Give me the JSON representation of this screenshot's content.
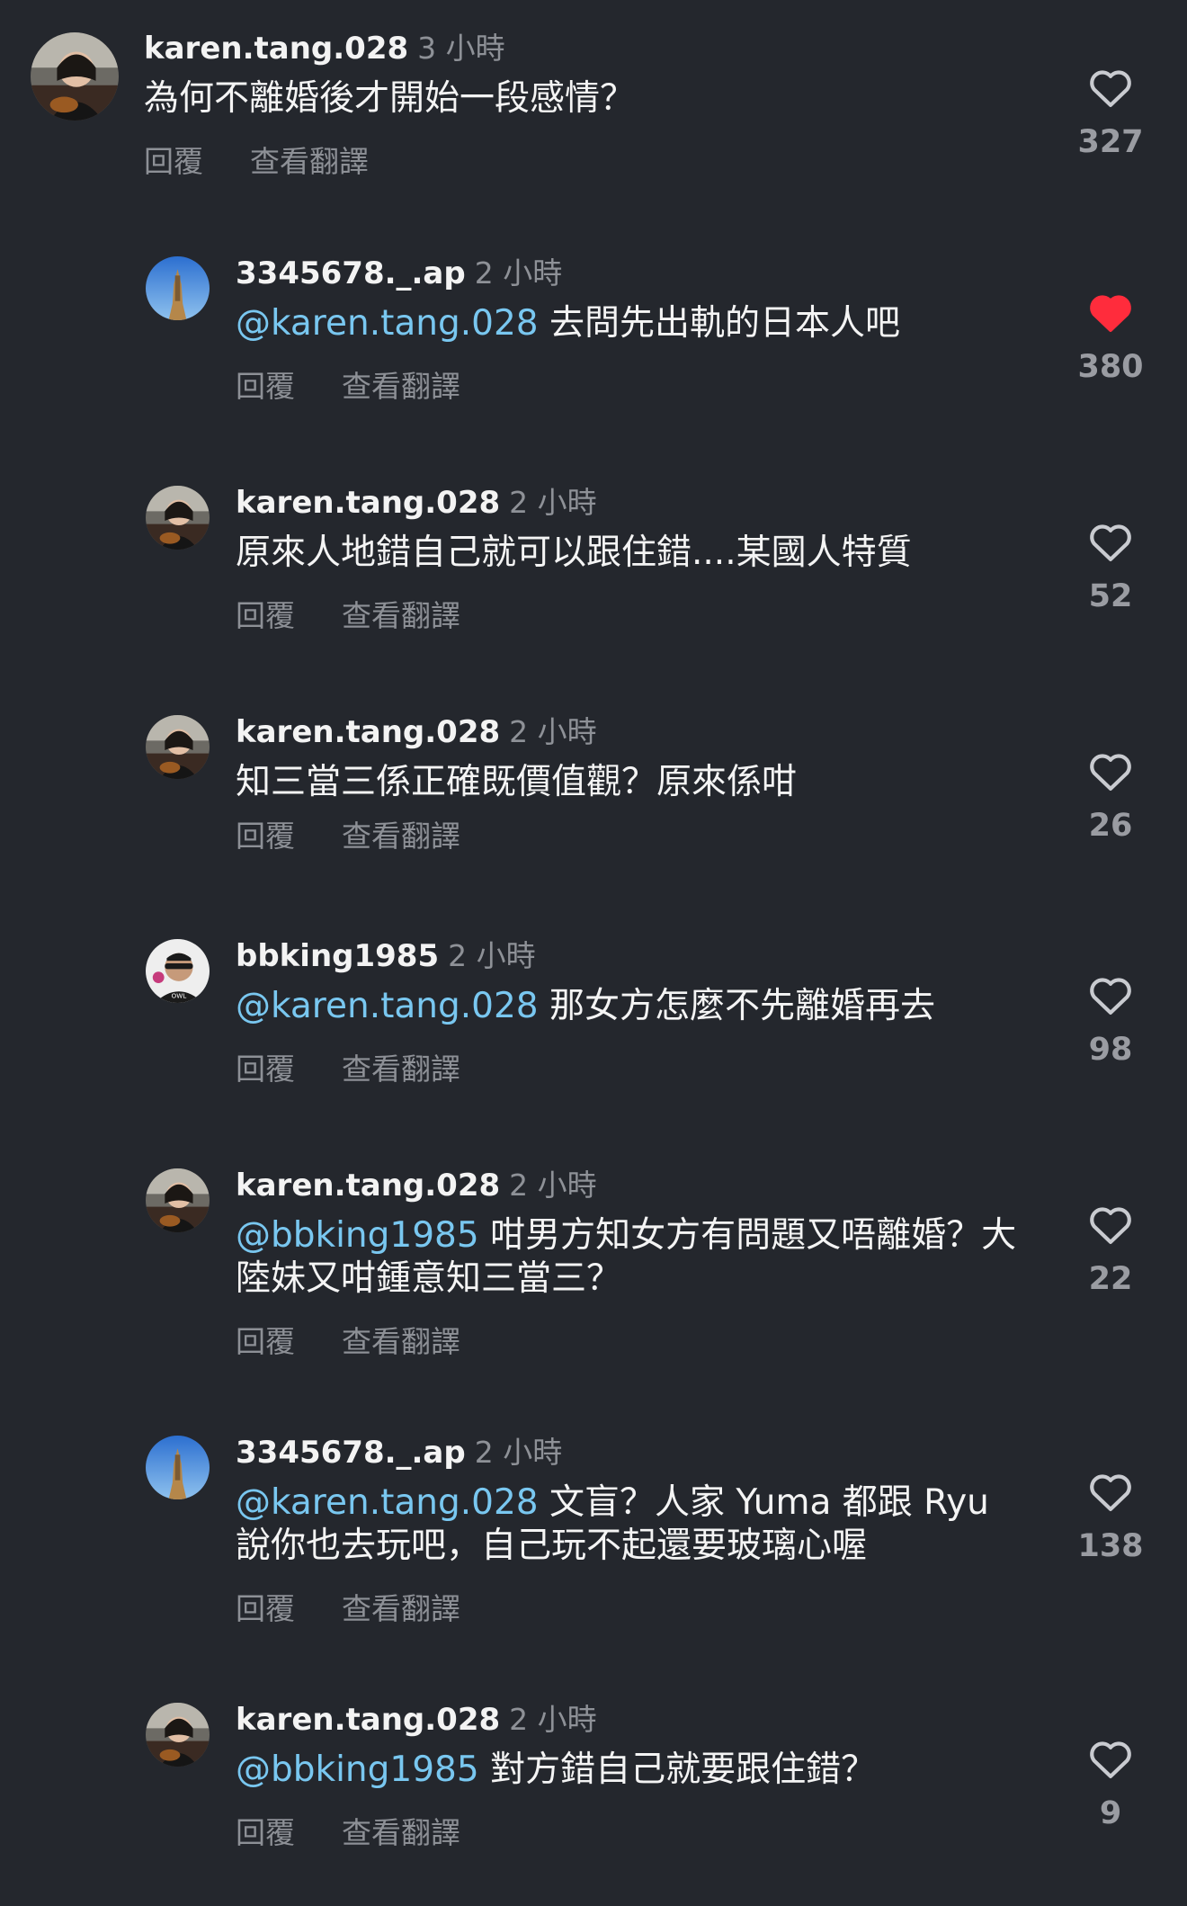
{
  "colors": {
    "background": "#24272d",
    "mention": "#79c7f0",
    "liked": "#ff2c3c",
    "muted": "#8d9096"
  },
  "actions": {
    "reply": "回覆",
    "translate": "查看翻譯"
  },
  "comments": [
    {
      "username": "karen.tang.028",
      "time": "3 小時",
      "mention": "",
      "text": "為何不離婚後才開始一段感情？",
      "likes": "327",
      "liked": false
    },
    {
      "username": "3345678._.ap",
      "time": "2 小時",
      "mention": "@karen.tang.028",
      "text": " 去問先出軌的日本人吧",
      "likes": "380",
      "liked": true
    },
    {
      "username": "karen.tang.028",
      "time": "2 小時",
      "mention": "",
      "text": "原來人地錯自己就可以跟住錯....某國人特質",
      "likes": "52",
      "liked": false
    },
    {
      "username": "karen.tang.028",
      "time": "2 小時",
      "mention": "",
      "text": "知三當三係正確既價值觀？原來係咁",
      "likes": "26",
      "liked": false
    },
    {
      "username": "bbking1985",
      "time": "2 小時",
      "mention": "@karen.tang.028",
      "text": " 那女方怎麼不先離婚再去",
      "likes": "98",
      "liked": false
    },
    {
      "username": "karen.tang.028",
      "time": "2 小時",
      "mention": "@bbking1985",
      "text": " 咁男方知女方有問題又唔離婚？大陸妹又咁鍾意知三當三？",
      "likes": "22",
      "liked": false
    },
    {
      "username": "3345678._.ap",
      "time": "2 小時",
      "mention": "@karen.tang.028",
      "text": " 文盲？人家 Yuma 都跟 Ryu 說你也去玩吧，自己玩不起還要玻璃心喔",
      "likes": "138",
      "liked": false
    },
    {
      "username": "karen.tang.028",
      "time": "2 小時",
      "mention": "@bbking1985",
      "text": " 對方錯自己就要跟住錯？",
      "likes": "9",
      "liked": false
    }
  ]
}
